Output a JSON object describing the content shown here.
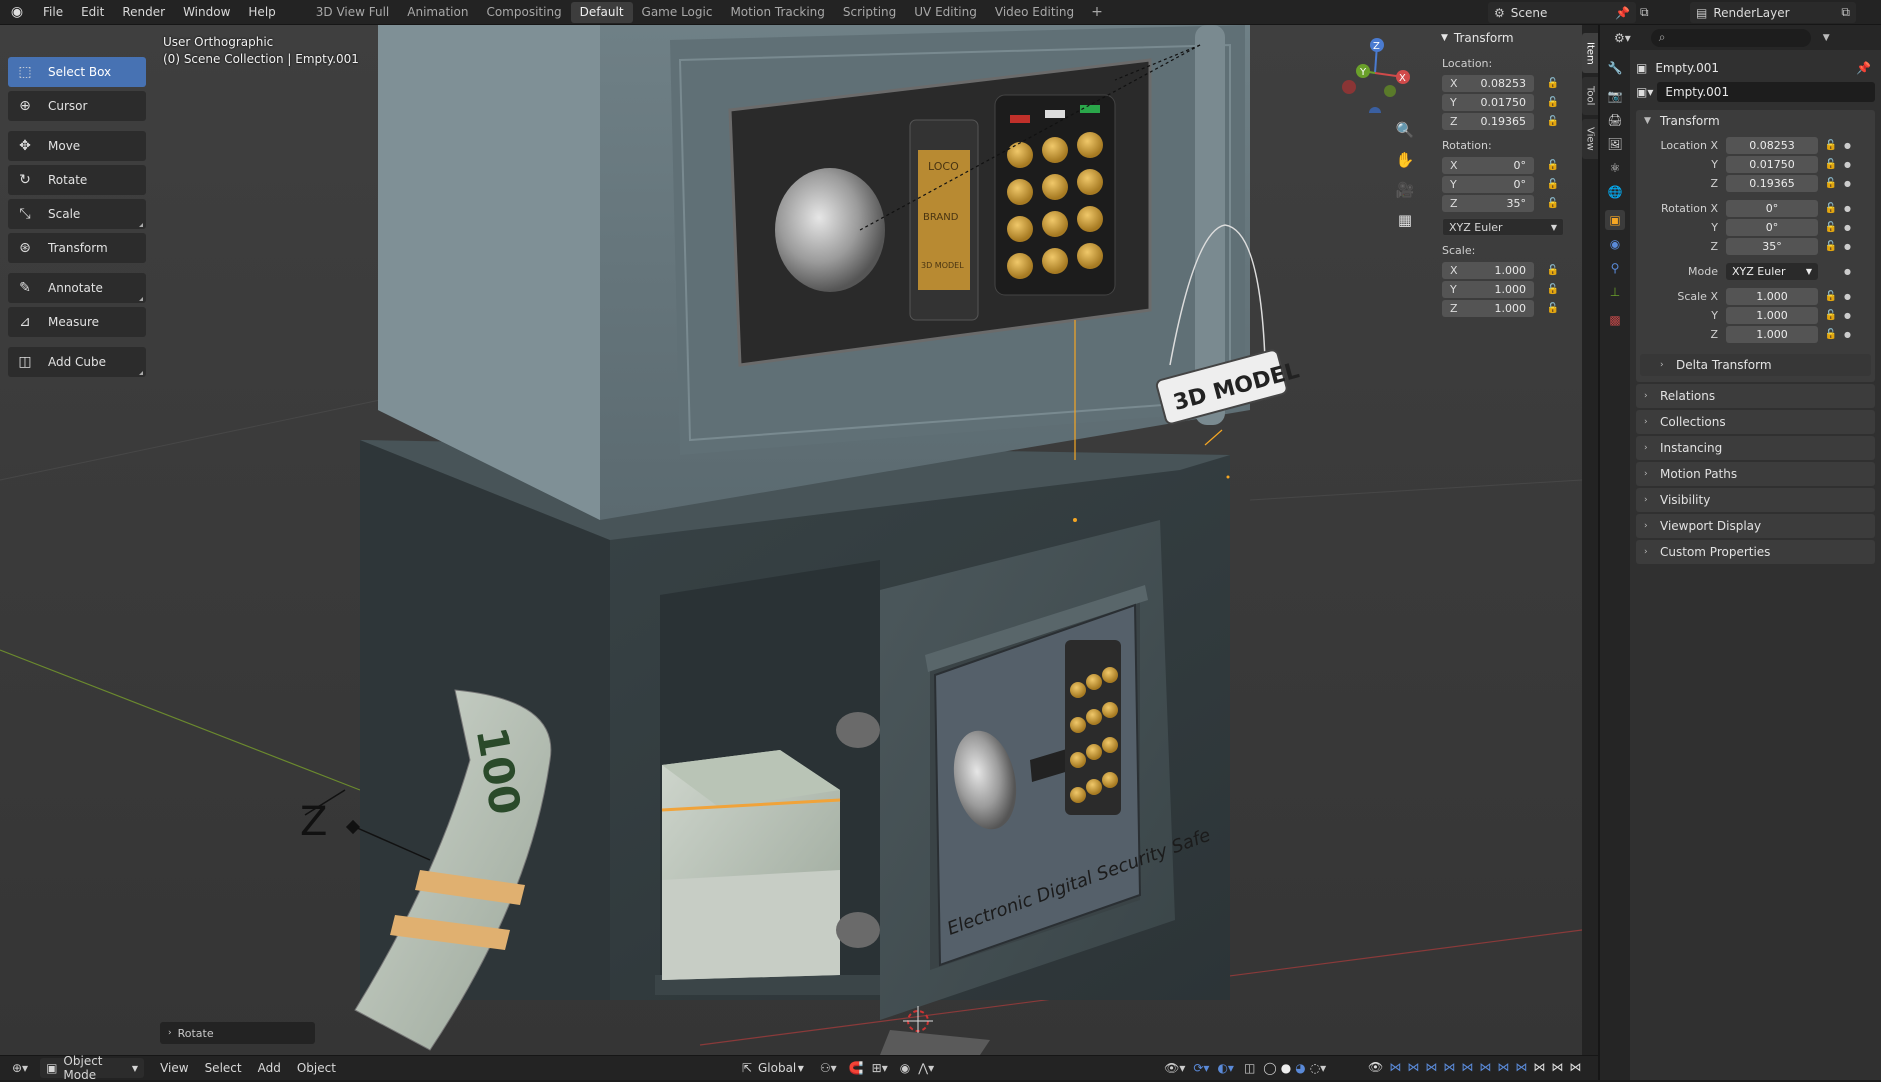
{
  "menu": [
    "File",
    "Edit",
    "Render",
    "Window",
    "Help"
  ],
  "workspaces": [
    {
      "label": "3D View Full",
      "active": false
    },
    {
      "label": "Animation",
      "active": false
    },
    {
      "label": "Compositing",
      "active": false
    },
    {
      "label": "Default",
      "active": true
    },
    {
      "label": "Game Logic",
      "active": false
    },
    {
      "label": "Motion Tracking",
      "active": false
    },
    {
      "label": "Scripting",
      "active": false
    },
    {
      "label": "UV Editing",
      "active": false
    },
    {
      "label": "Video Editing",
      "active": false
    }
  ],
  "workspace_add": "+",
  "scene": "Scene",
  "render_layer": "RenderLayer",
  "tools": [
    {
      "label": "Select Box",
      "icon": "select-box-icon",
      "glyph": "⬚",
      "active": true
    },
    {
      "label": "Cursor",
      "icon": "cursor-icon",
      "glyph": "⊕",
      "active": false
    },
    {
      "label": "Move",
      "icon": "move-icon",
      "glyph": "✥",
      "active": false
    },
    {
      "label": "Rotate",
      "icon": "rotate-icon",
      "glyph": "↻",
      "active": false
    },
    {
      "label": "Scale",
      "icon": "scale-icon",
      "glyph": "⤡",
      "active": false
    },
    {
      "label": "Transform",
      "icon": "transform-icon",
      "glyph": "⊛",
      "active": false
    },
    {
      "label": "Annotate",
      "icon": "annotate-icon",
      "glyph": "✎",
      "active": false
    },
    {
      "label": "Measure",
      "icon": "measure-icon",
      "glyph": "📐",
      "active": false
    },
    {
      "label": "Add Cube",
      "icon": "add-cube-icon",
      "glyph": "◫",
      "active": false
    }
  ],
  "viewport": {
    "view_name": "User Orthographic",
    "collection_path": "(0) Scene Collection | Empty.001",
    "scene_texts": {
      "tag": "3D MODEL",
      "plate": "Electronic Digital Security Safe",
      "brand_top": "LOCO",
      "brand_mid": "BRAND",
      "brand_bottom": "3D MODEL",
      "bill": "100"
    }
  },
  "npanel": {
    "title": "Transform",
    "location_label": "Location:",
    "location": [
      {
        "axis": "X",
        "value": "0.08253"
      },
      {
        "axis": "Y",
        "value": "0.01750"
      },
      {
        "axis": "Z",
        "value": "0.19365"
      }
    ],
    "rotation_label": "Rotation:",
    "rotation": [
      {
        "axis": "X",
        "value": "0°"
      },
      {
        "axis": "Y",
        "value": "0°"
      },
      {
        "axis": "Z",
        "value": "35°"
      }
    ],
    "rotation_mode": "XYZ Euler",
    "scale_label": "Scale:",
    "scale": [
      {
        "axis": "X",
        "value": "1.000"
      },
      {
        "axis": "Y",
        "value": "1.000"
      },
      {
        "axis": "Z",
        "value": "1.000"
      }
    ]
  },
  "side_tabs": [
    "Item",
    "Tool",
    "View"
  ],
  "properties": {
    "object_name": "Empty.001",
    "data_name": "Empty.001",
    "transform_title": "Transform",
    "location": [
      {
        "label": "Location X",
        "value": "0.08253"
      },
      {
        "label": "Y",
        "value": "0.01750"
      },
      {
        "label": "Z",
        "value": "0.19365"
      }
    ],
    "rotation": [
      {
        "label": "Rotation X",
        "value": "0°"
      },
      {
        "label": "Y",
        "value": "0°"
      },
      {
        "label": "Z",
        "value": "35°"
      }
    ],
    "mode_label": "Mode",
    "mode_value": "XYZ Euler",
    "scale": [
      {
        "label": "Scale X",
        "value": "1.000"
      },
      {
        "label": "Y",
        "value": "1.000"
      },
      {
        "label": "Z",
        "value": "1.000"
      }
    ],
    "delta_transform": "Delta Transform",
    "sections": [
      "Relations",
      "Collections",
      "Instancing",
      "Motion Paths",
      "Visibility",
      "Viewport Display",
      "Custom Properties"
    ]
  },
  "bottom": {
    "mode": "Object Mode",
    "menus": [
      "View",
      "Select",
      "Add",
      "Object"
    ],
    "orientation": "Global",
    "last_op": "Rotate"
  },
  "colors": {
    "accent": "#4772b3",
    "active_object": "#f5a623"
  }
}
